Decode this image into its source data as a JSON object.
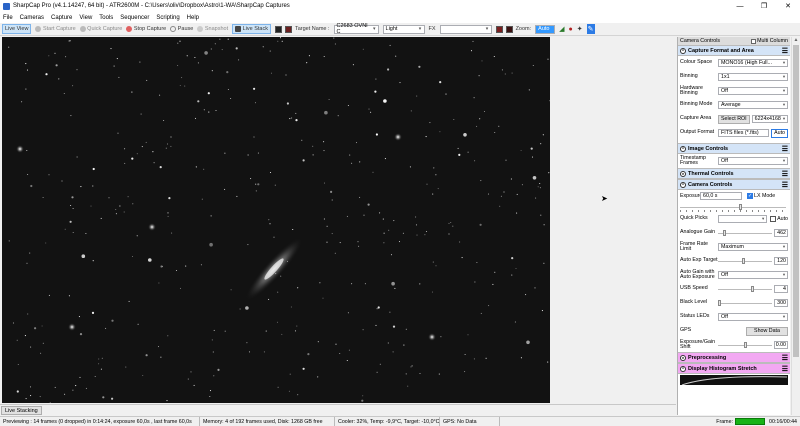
{
  "window": {
    "title": "SharpCap Pro (v4.1.14247, 64 bit) - ATR2600M - C:\\Users\\oliv\\Dropbox\\Astro\\1-WA\\SharpCap Captures",
    "minimize": "—",
    "maximize": "❐",
    "close": "✕"
  },
  "menu": [
    "File",
    "Cameras",
    "Capture",
    "View",
    "Tools",
    "Sequencer",
    "Scripting",
    "Help"
  ],
  "toolbar": {
    "live_view": "Live View",
    "start_capture": "Start Capture",
    "quick_capture": "Quick Capture",
    "stop_capture": "Stop Capture",
    "pause": "Pause",
    "snapshot": "Snapshot",
    "live_stack": "Live Stack",
    "target_label": "Target Name :",
    "target_value": "C2683 OVNI C",
    "light_value": "Light",
    "fx_label": "FX",
    "zoom_label": "Zoom:",
    "zoom_value": "Auto"
  },
  "panel": {
    "header_left": "Camera Controls",
    "header_right": "Multi Column",
    "capture_format": {
      "title": "Capture Format and Area",
      "colour_space_label": "Colour Space",
      "colour_space_value": "MONO16 (High Full...",
      "binning_label": "Binning",
      "binning_value": "1x1",
      "hw_binning_label": "Hardware Binning",
      "hw_binning_value": "Off",
      "binning_mode_label": "Binning Mode",
      "binning_mode_value": "Average",
      "capture_area_label": "Capture Area",
      "select_roi": "Select ROI",
      "capture_area_value": "6224x4168",
      "output_format_label": "Output Format",
      "output_format_value": "FITS files (*.fits)",
      "auto": "Auto"
    },
    "image_controls": {
      "title": "Image Controls",
      "timestamp_label": "Timestamp Frames",
      "timestamp_value": "Off"
    },
    "thermal": {
      "title": "Thermal Controls"
    },
    "camera_controls": {
      "title": "Camera Controls",
      "exposure_label": "Exposure",
      "exposure_value": "60,0 s",
      "lx_mode": "LX Mode",
      "quick_picks_label": "Quick Picks",
      "auto": "Auto",
      "analogue_gain_label": "Analogue Gain",
      "analogue_gain_value": "462",
      "frame_rate_label": "Frame Rate Limit",
      "frame_rate_value": "Maximum",
      "auto_exp_label": "Auto Exp Target",
      "auto_exp_value": "120",
      "auto_gain_label": "Auto Gain with Auto Exposure",
      "auto_gain_value": "Off",
      "usb_speed_label": "USB Speed",
      "usb_speed_value": "4",
      "black_level_label": "Black Level",
      "black_level_value": "300",
      "status_leds_label": "Status LEDs",
      "status_leds_value": "Off",
      "gps_label": "GPS",
      "show_data": "Show Data",
      "exposure_gain_label": "Exposure/Gain Shift",
      "exposure_gain_value": "0.00"
    },
    "preprocessing": {
      "title": "Preprocessing"
    },
    "histogram": {
      "title": "Display Histogram Stretch"
    }
  },
  "tabs": {
    "live_stacking": "Live Stacking"
  },
  "status": {
    "previewing": "Previewing : 14 frames (0 dropped) in 0:14:24, exposure 60,0s , last frame 60,0s",
    "memory": "Memory: 4 of 192 frames used, Disk: 1268 GB free",
    "cooler": "Cooler: 32%, Temp: -9,9°C, Target: -10,0°C",
    "gps": "GPS: No Data",
    "frame_label": "Frame:",
    "frame_time": "00:16/00:44"
  },
  "colors": {
    "accent_blue": "#3399ff",
    "section_blue": "#d4e4f7",
    "section_pink": "#f2a8f2",
    "frame_progress": "#17b317"
  }
}
